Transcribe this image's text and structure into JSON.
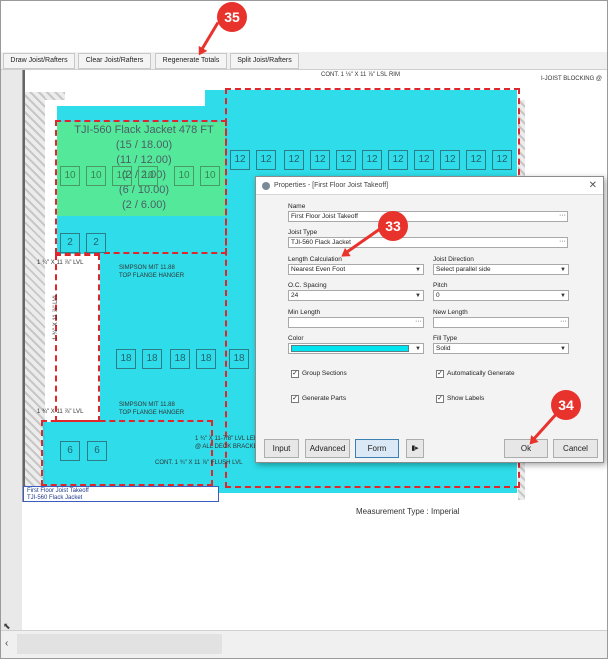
{
  "toolbar": {
    "buttons": [
      "Draw Joist/Rafters",
      "Clear Joist/Rafters",
      "Regenerate Totals",
      "Split Joist/Rafters"
    ]
  },
  "plan": {
    "takeoff_lines": [
      "TJI-560 Flack Jacket 478 FT",
      "(15 / 18.00)",
      "(11 / 12.00)",
      "(2 / 2.00)",
      "(6 / 10.00)",
      "(2 / 6.00)"
    ],
    "labels": {
      "rim": "CONT. 1 ⅛\" X 11 ⅞\" LSL RIM",
      "blocking": "I-JOIST BLOCKING @",
      "hanger1": "SIMPSON MIT 11.88",
      "hanger1b": "TOP FLANGE HANGER",
      "hanger2": "SIMPSON MIT 11.88",
      "hanger2b": "TOP FLANGE HANGER",
      "lvl": "1 ¾\" X 11 ⅞\" LVL",
      "lvl2": "1 ¾\" X 11 ⅞\" LVL",
      "lvl_vert": "1 ¾\" X 11 ⅞\" LVL",
      "ledger": "1 ¾\" X 11-7/8\" LVL LEDGER",
      "deck": "@ ALL DECK BRACKET LOCATION",
      "flush": "CONT. 1 ¾\" X 11 ⅞\" FLUSH LVL",
      "mini1": "First Floor Joist Takeoff",
      "mini2": "TJI-560 Flack Jacket"
    },
    "cells_top": [
      "12",
      "12",
      "12",
      "12",
      "12",
      "12",
      "12",
      "12",
      "12",
      "12",
      "12"
    ],
    "cells_green": [
      "10",
      "10",
      "10",
      "10",
      "10",
      "10"
    ],
    "cells_mid": [
      "18",
      "18",
      "18",
      "18",
      "18"
    ],
    "cells_small": [
      "2",
      "2"
    ],
    "cells_bottom": [
      "6",
      "6"
    ]
  },
  "measurement": "Measurement Type : Imperial",
  "dialog": {
    "title": "Properties - [First Floor Joist Takeoff]",
    "name_label": "Name",
    "name_value": "First Floor Joist Takeoff",
    "joist_type_label": "Joist Type",
    "joist_type_value": "TJI-560 Flack Jacket",
    "length_calc_label": "Length Calculation",
    "length_calc_value": "Nearest Even Foot",
    "joist_direction_label": "Joist Direction",
    "joist_direction_value": "Select parallel side",
    "oc_spacing_label": "O.C. Spacing",
    "oc_spacing_value": "24",
    "pitch_label": "Pitch",
    "pitch_value": "0",
    "min_length_label": "Min Length",
    "min_length_value": "",
    "new_length_label": "New Length",
    "new_length_value": "",
    "color_label": "Color",
    "color_value": "#00e5ef",
    "fill_type_label": "Fill Type",
    "fill_type_value": "Solid",
    "group_sections": "Group Sections",
    "automatically_generate": "Automatically Generate",
    "generate_parts": "Generate Parts",
    "show_labels": "Show Labels",
    "btn_input": "Input",
    "btn_advanced": "Advanced",
    "btn_form": "Form",
    "btn_ok": "Ok",
    "btn_cancel": "Cancel"
  },
  "callouts": [
    "35",
    "33",
    "34"
  ],
  "colors": {
    "accent": "#e8332d",
    "cyan": "#00d6e4",
    "green": "#5aeb8c"
  }
}
